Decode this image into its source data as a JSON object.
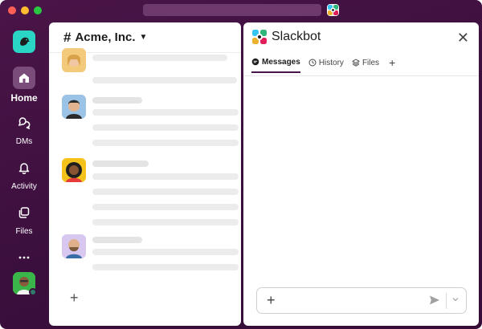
{
  "window": {
    "accent": "#4a154b"
  },
  "rail": {
    "items": [
      {
        "label": "Home",
        "icon": "home-icon",
        "active": true
      },
      {
        "label": "DMs",
        "icon": "dms-icon"
      },
      {
        "label": "Activity",
        "icon": "bell-icon"
      },
      {
        "label": "Files",
        "icon": "files-icon"
      },
      {
        "label": "More",
        "icon": "more-icon"
      }
    ]
  },
  "channel": {
    "workspace_name": "Acme, Inc.",
    "hash": "#"
  },
  "slackbot": {
    "title": "Slackbot",
    "tabs": [
      {
        "label": "Messages",
        "icon": "message-icon",
        "active": true
      },
      {
        "label": "History",
        "icon": "clock-icon"
      },
      {
        "label": "Files",
        "icon": "layers-icon"
      }
    ]
  }
}
